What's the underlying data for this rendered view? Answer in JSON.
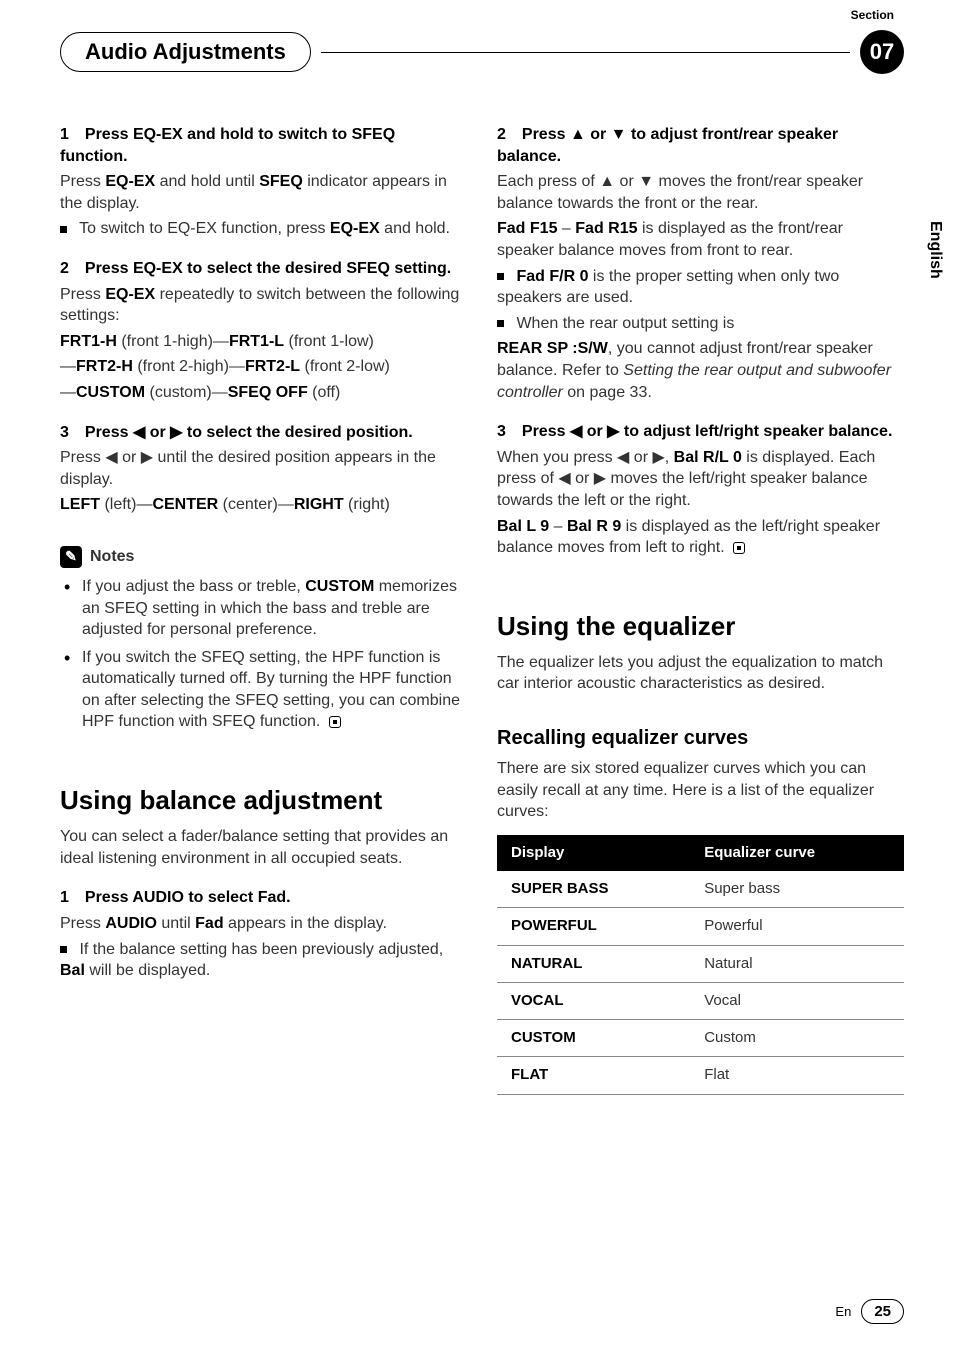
{
  "header": {
    "section_label": "Section",
    "title": "Audio Adjustments",
    "section_number": "07"
  },
  "side_tab": "English",
  "left": {
    "step1_head": "1 Press EQ-EX and hold to switch to SFEQ function.",
    "step1_body_a": "Press ",
    "step1_eqex": "EQ-EX",
    "step1_body_b": " and hold until ",
    "step1_sfeq": "SFEQ",
    "step1_body_c": " indicator appears in the display.",
    "step1_bullet_a": "To switch to EQ-EX function, press ",
    "step1_bullet_b": " and hold.",
    "step2_head": "2 Press EQ-EX to select the desired SFEQ setting.",
    "step2_body_a": "Press ",
    "step2_body_b": " repeatedly to switch between the following settings:",
    "settings_line1_a": "FRT1-H",
    "settings_line1_b": " (front 1-high)—",
    "settings_line1_c": "FRT1-L",
    "settings_line1_d": " (front 1-low)",
    "settings_line2_a": "—",
    "settings_line2_b": "FRT2-H",
    "settings_line2_c": " (front 2-high)—",
    "settings_line2_d": "FRT2-L",
    "settings_line2_e": " (front 2-low)",
    "settings_line3_a": "—",
    "settings_line3_b": "CUSTOM",
    "settings_line3_c": " (custom)—",
    "settings_line3_d": "SFEQ OFF",
    "settings_line3_e": " (off)",
    "step3_head": "3 Press ◀ or ▶ to select the desired position.",
    "step3_body": "Press ◀ or ▶ until the desired position appears in the display.",
    "positions_a": "LEFT",
    "positions_b": " (left)—",
    "positions_c": "CENTER",
    "positions_d": " (center)—",
    "positions_e": "RIGHT",
    "positions_f": " (right)",
    "notes_label": "Notes",
    "note1_a": "If you adjust the bass or treble, ",
    "note1_b": "CUSTOM",
    "note1_c": " memorizes an SFEQ setting in which the bass and treble are adjusted for personal preference.",
    "note2": "If you switch the SFEQ setting, the HPF function is automatically turned off. By turning the HPF function on after selecting the SFEQ setting, you can combine HPF function with SFEQ function.",
    "balance_title": "Using balance adjustment",
    "balance_intro": "You can select a fader/balance setting that provides an ideal listening environment in all occupied seats.",
    "bal_step1_head": "1 Press AUDIO to select Fad.",
    "bal_step1_a": "Press ",
    "bal_step1_b": "AUDIO",
    "bal_step1_c": " until ",
    "bal_step1_d": "Fad",
    "bal_step1_e": " appears in the display.",
    "bal_bullet_a": "If the balance setting has been previously adjusted, ",
    "bal_bullet_b": "Bal",
    "bal_bullet_c": " will be displayed."
  },
  "right": {
    "step2_head": "2 Press ▲ or ▼ to adjust front/rear speaker balance.",
    "step2_body": "Each press of ▲ or ▼ moves the front/rear speaker balance towards the front or the rear.",
    "step2_range_a": "Fad F15",
    "step2_range_b": " – ",
    "step2_range_c": "Fad R15",
    "step2_range_d": " is displayed as the front/rear speaker balance moves from front to rear.",
    "step2_bullet1_a": "Fad F/R 0",
    "step2_bullet1_b": " is the proper setting when only two speakers are used.",
    "step2_bullet2_a": "When the rear output setting is",
    "step2_bullet2_b": "REAR SP :S/W",
    "step2_bullet2_c": ", you cannot adjust front/rear speaker balance. Refer to ",
    "step2_bullet2_em": "Setting the rear output and subwoofer controller",
    "step2_bullet2_d": " on page 33.",
    "step3_head": "3 Press ◀ or ▶ to adjust left/right speaker balance.",
    "step3_body_a": "When you press ◀ or ▶, ",
    "step3_body_b": "Bal R/L 0",
    "step3_body_c": " is displayed. Each press of ◀ or ▶ moves the left/right speaker balance towards the left or the right.",
    "step3_range_a": "Bal L 9",
    "step3_range_b": " – ",
    "step3_range_c": "Bal R 9",
    "step3_range_d": " is displayed as the left/right speaker balance moves from left to right.",
    "eq_title": "Using the equalizer",
    "eq_intro": "The equalizer lets you adjust the equalization to match car interior acoustic characteristics as desired.",
    "recall_title": "Recalling equalizer curves",
    "recall_intro": "There are six stored equalizer curves which you can easily recall at any time. Here is a list of the equalizer curves:",
    "table": {
      "col1": "Display",
      "col2": "Equalizer curve",
      "rows": [
        {
          "d": "SUPER BASS",
          "c": "Super bass"
        },
        {
          "d": "POWERFUL",
          "c": "Powerful"
        },
        {
          "d": "NATURAL",
          "c": "Natural"
        },
        {
          "d": "VOCAL",
          "c": "Vocal"
        },
        {
          "d": "CUSTOM",
          "c": "Custom"
        },
        {
          "d": "FLAT",
          "c": "Flat"
        }
      ]
    }
  },
  "footer": {
    "lang": "En",
    "page": "25"
  }
}
